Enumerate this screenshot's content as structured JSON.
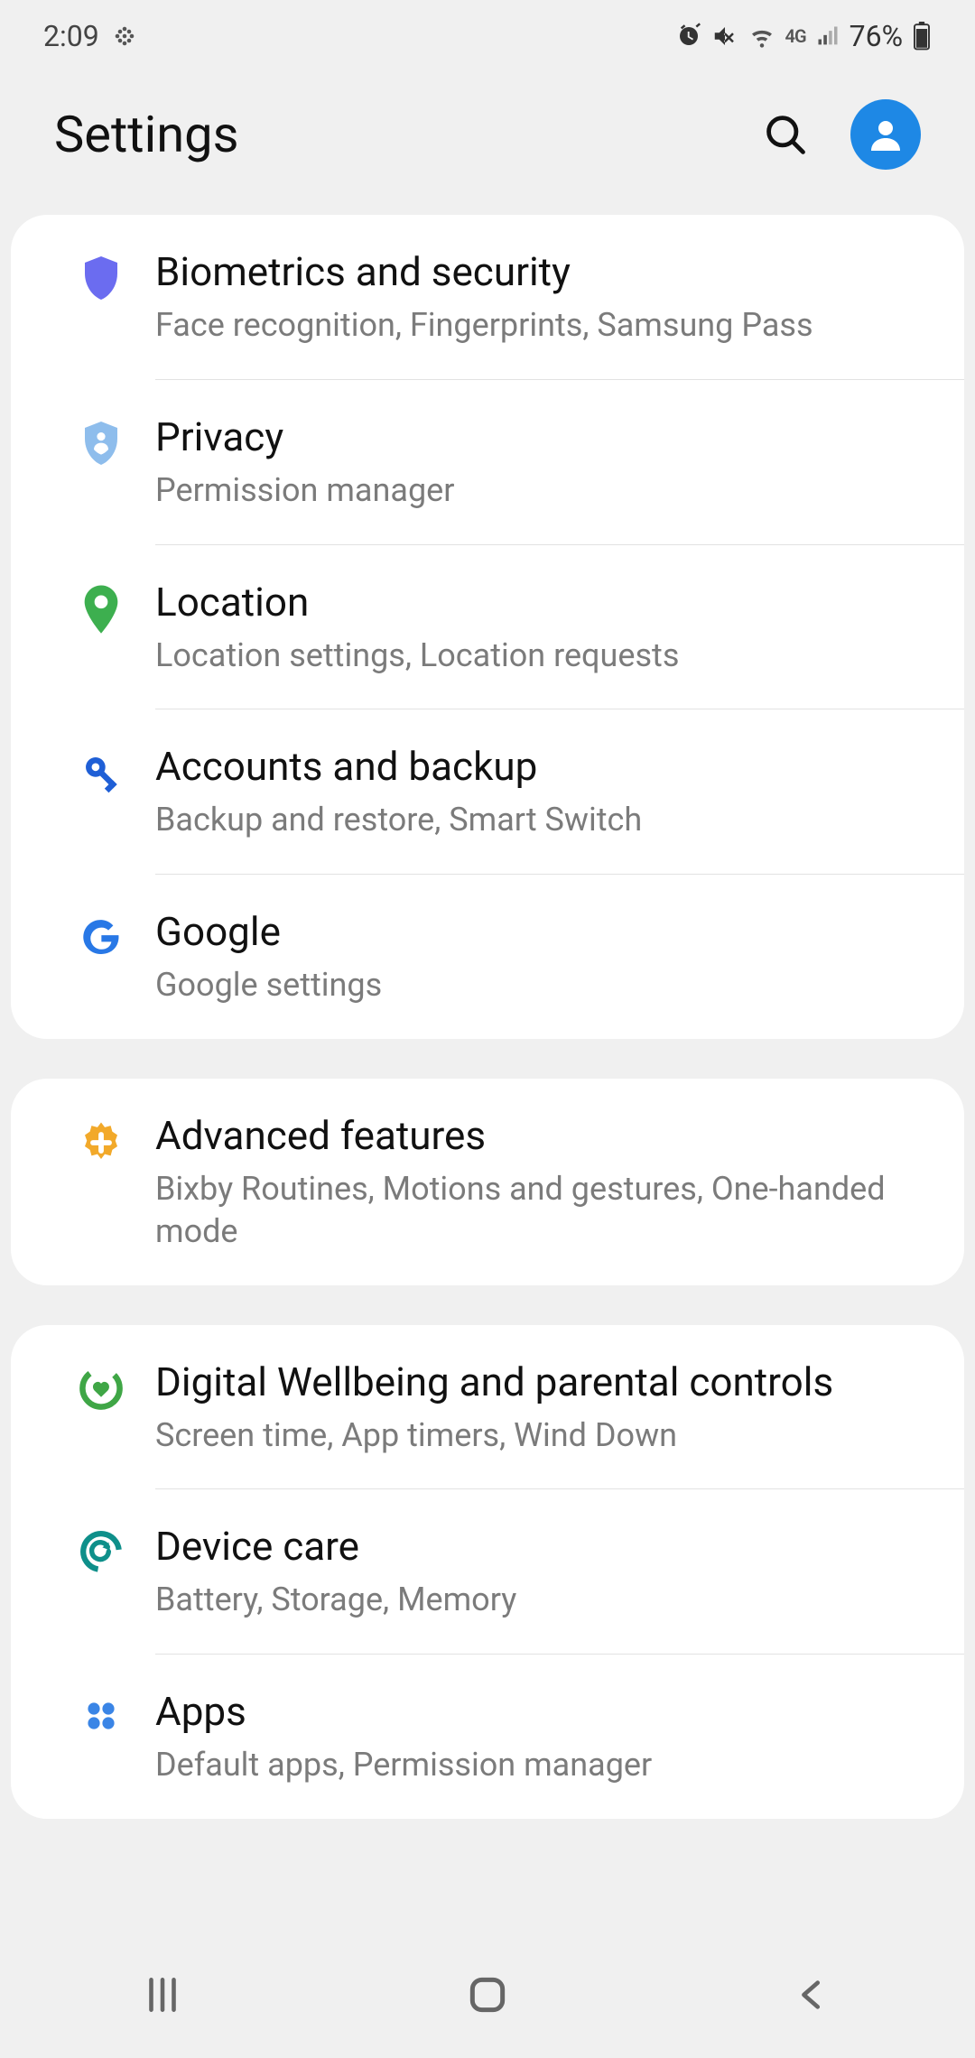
{
  "status": {
    "time": "2:09",
    "battery": "76%"
  },
  "header": {
    "title": "Settings"
  },
  "groups": [
    {
      "items": [
        {
          "id": "biometrics",
          "icon": "shield-solid",
          "iconColor": "#6b6cf0",
          "title": "Biometrics and security",
          "subtitle": "Face recognition, Fingerprints, Samsung Pass"
        },
        {
          "id": "privacy",
          "icon": "shield-user",
          "iconColor": "#8ebdec",
          "title": "Privacy",
          "subtitle": "Permission manager"
        },
        {
          "id": "location",
          "icon": "pin",
          "iconColor": "#3daf4f",
          "title": "Location",
          "subtitle": "Location settings, Location requests"
        },
        {
          "id": "accounts",
          "icon": "key",
          "iconColor": "#1f5fd6",
          "title": "Accounts and backup",
          "subtitle": "Backup and restore, Smart Switch"
        },
        {
          "id": "google",
          "icon": "google",
          "iconColor": "#2878e6",
          "title": "Google",
          "subtitle": "Google settings"
        }
      ]
    },
    {
      "items": [
        {
          "id": "advanced",
          "icon": "gear-plus",
          "iconColor": "#f2a92a",
          "title": "Advanced features",
          "subtitle": "Bixby Routines, Motions and gestures, One-handed mode"
        }
      ]
    },
    {
      "items": [
        {
          "id": "wellbeing",
          "icon": "heart-ring",
          "iconColor": "#3fa646",
          "title": "Digital Wellbeing and parental controls",
          "subtitle": "Screen time, App timers, Wind Down"
        },
        {
          "id": "device-care",
          "icon": "refresh-ring",
          "iconColor": "#0e8f8a",
          "title": "Device care",
          "subtitle": "Battery, Storage, Memory"
        },
        {
          "id": "apps",
          "icon": "dots",
          "iconColor": "#3a85e6",
          "title": "Apps",
          "subtitle": "Default apps, Permission manager"
        }
      ]
    }
  ]
}
